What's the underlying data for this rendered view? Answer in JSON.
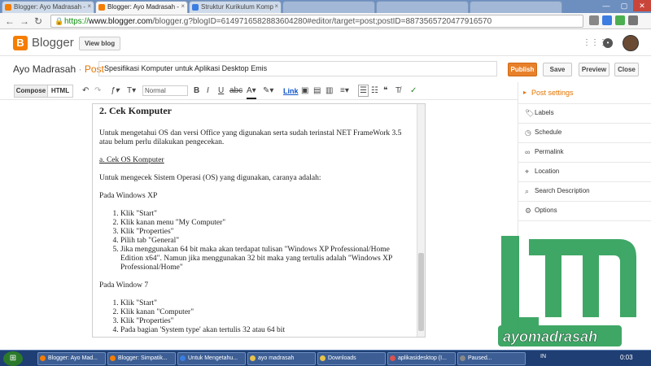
{
  "browser": {
    "tabs": [
      {
        "label": "Blogger: Ayo Madrasah -",
        "color": "#f57d00"
      },
      {
        "label": "Blogger: Ayo Madrasah -",
        "color": "#f57d00",
        "active": true
      },
      {
        "label": "Struktur Kurikulum Komp",
        "color": "#3b7de0"
      }
    ],
    "url_scheme": "https://",
    "url_host": "www.blogger.com",
    "url_path": "/blogger.g?blogID=6149716582883604280#editor/target=post;postID=8873565720477916570"
  },
  "blogger": {
    "brand": "Blogger",
    "view_blog": "View blog",
    "grid_icon": "apps-grid-icon",
    "notification_icon": "notification-bell-icon"
  },
  "post": {
    "blog_name": "Ayo Madrasah",
    "separator": "·",
    "post_label": "Post",
    "title": "Spesifikasi Komputer untuk Aplikasi Desktop Emis",
    "publish": "Publish",
    "save": "Save",
    "preview": "Preview",
    "close": "Close"
  },
  "toolbar": {
    "compose": "Compose",
    "html": "HTML",
    "font_style": "Normal",
    "link": "Link"
  },
  "editor": {
    "heading": "2. Cek Komputer",
    "p1": "Untuk mengetahui OS dan versi Office yang digunakan serta sudah terinstal NET FrameWork 3.5 atau belum perlu dilakukan pengecekan.",
    "p2": "a. Cek OS Komputer",
    "p3": "Untuk mengecek Sistem Operasi (OS) yang digunakan, caranya adalah:",
    "p4": "Pada Windows XP",
    "xp_steps": [
      "Klik \"Start\"",
      "Klik kanan menu \"My Computer\"",
      "Klik \"Properties\"",
      "Pilih tab \"General\"",
      "Jika menggunakan 64 bit maka akan terdapat tulisan \"Windows XP Professional/Home Edition x64\". Namun jika menggunakan 32 bit maka yang tertulis adalah \"Windows XP Professional/Home\""
    ],
    "p5": "Pada Window 7",
    "w7_steps": [
      "Klik \"Start\"",
      "Klik kanan \"Computer\"",
      "Klik \"Properties\"",
      "Pada bagian 'System type' akan tertulis 32 atau 64 bit"
    ]
  },
  "sidebar": {
    "header": "Post settings",
    "items": [
      {
        "label": "Labels",
        "icon": "tag-icon"
      },
      {
        "label": "Schedule",
        "icon": "clock-icon"
      },
      {
        "label": "Permalink",
        "icon": "link-icon"
      },
      {
        "label": "Location",
        "icon": "location-pin-icon"
      },
      {
        "label": "Search Description",
        "icon": "search-icon"
      },
      {
        "label": "Options",
        "icon": "gear-icon"
      }
    ]
  },
  "watermark": {
    "text": "ayomadrasah",
    "color": "#2fa05a"
  },
  "taskbar": {
    "items": [
      {
        "label": "Blogger: Ayo Mad...",
        "color": "#f57d00"
      },
      {
        "label": "Blogger: Simpatik...",
        "color": "#f57d00"
      },
      {
        "label": "Untuk Mengetahu...",
        "color": "#3b7de0"
      },
      {
        "label": "ayo madrasah",
        "color": "#e8c34a"
      },
      {
        "label": "Downloads",
        "color": "#e8c34a"
      },
      {
        "label": "aplikasidesktop (I...",
        "color": "#d9534f"
      },
      {
        "label": "Paused...",
        "color": "#888888"
      }
    ],
    "lang": "IN",
    "time": "0:03"
  }
}
